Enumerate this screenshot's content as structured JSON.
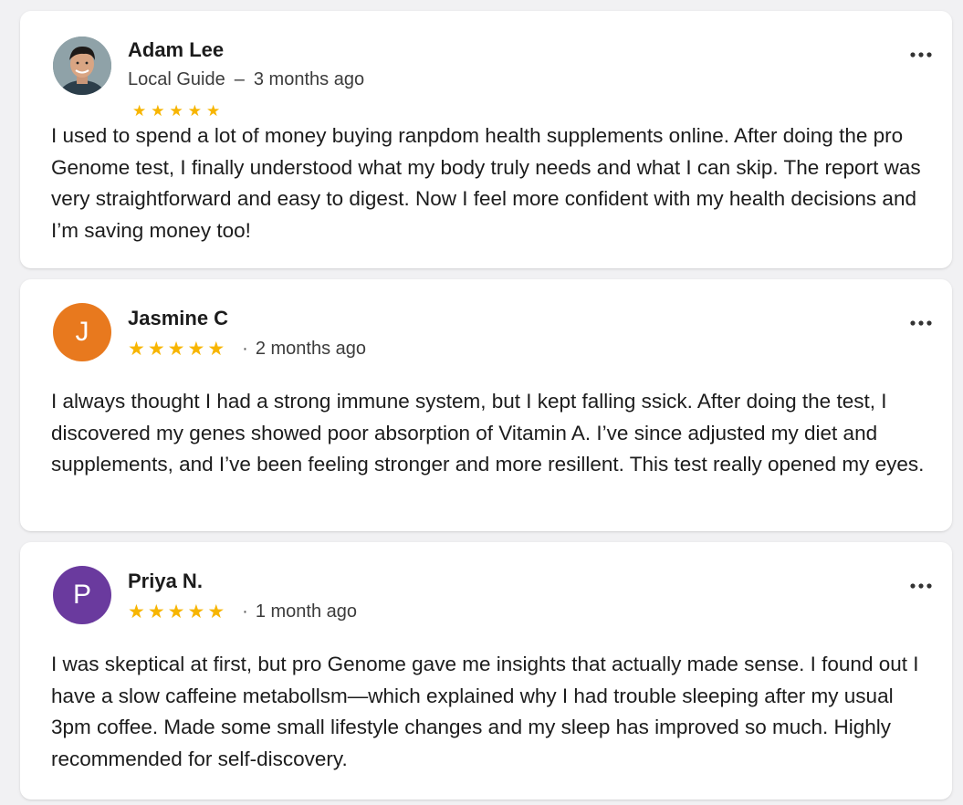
{
  "reviews": [
    {
      "name": "Adam Lee",
      "badge": "Local Guide",
      "separator": "–",
      "time": "3 months ago",
      "rating": 5,
      "avatar": {
        "type": "photo",
        "icon": "user-photo"
      },
      "text": "I used to spend a lot of money buying ranpdom health supplements online. After doing the pro Genome test, I finally understood what my body truly needs and what I can skip. The report was very straightforward and easy to digest. Now I feel more confident with my health decisions and I’m saving money too!"
    },
    {
      "name": "Jasmine C",
      "separator": "·",
      "time": "2 months ago",
      "rating": 5,
      "avatar": {
        "type": "letter",
        "letter": "J",
        "color": "#e8791e"
      },
      "text": "I always thought I had a strong immune system, but I kept falling ssick. After doing the test, I discovered my genes showed poor absorption of Vitamin A. I’ve since adjusted my diet and supplements, and I’ve been feeling stronger and more resillent. This test really opened my eyes."
    },
    {
      "name": "Priya N.",
      "separator": "·",
      "time": "1 month ago",
      "rating": 5,
      "avatar": {
        "type": "letter",
        "letter": "P",
        "color": "#6a3a9e"
      },
      "text": "I was skeptical at first, but pro Genome gave me insights that actually made sense. I found out I have a slow caffeine metabollsm—which explained why I had trouble sleeping after my usual 3pm coffee. Made some small lifestyle changes and my sleep has improved so much. Highly recommended for self-discovery."
    }
  ],
  "colors": {
    "star": "#f7b500",
    "card_bg": "#ffffff",
    "page_bg": "#f1f1f3"
  }
}
